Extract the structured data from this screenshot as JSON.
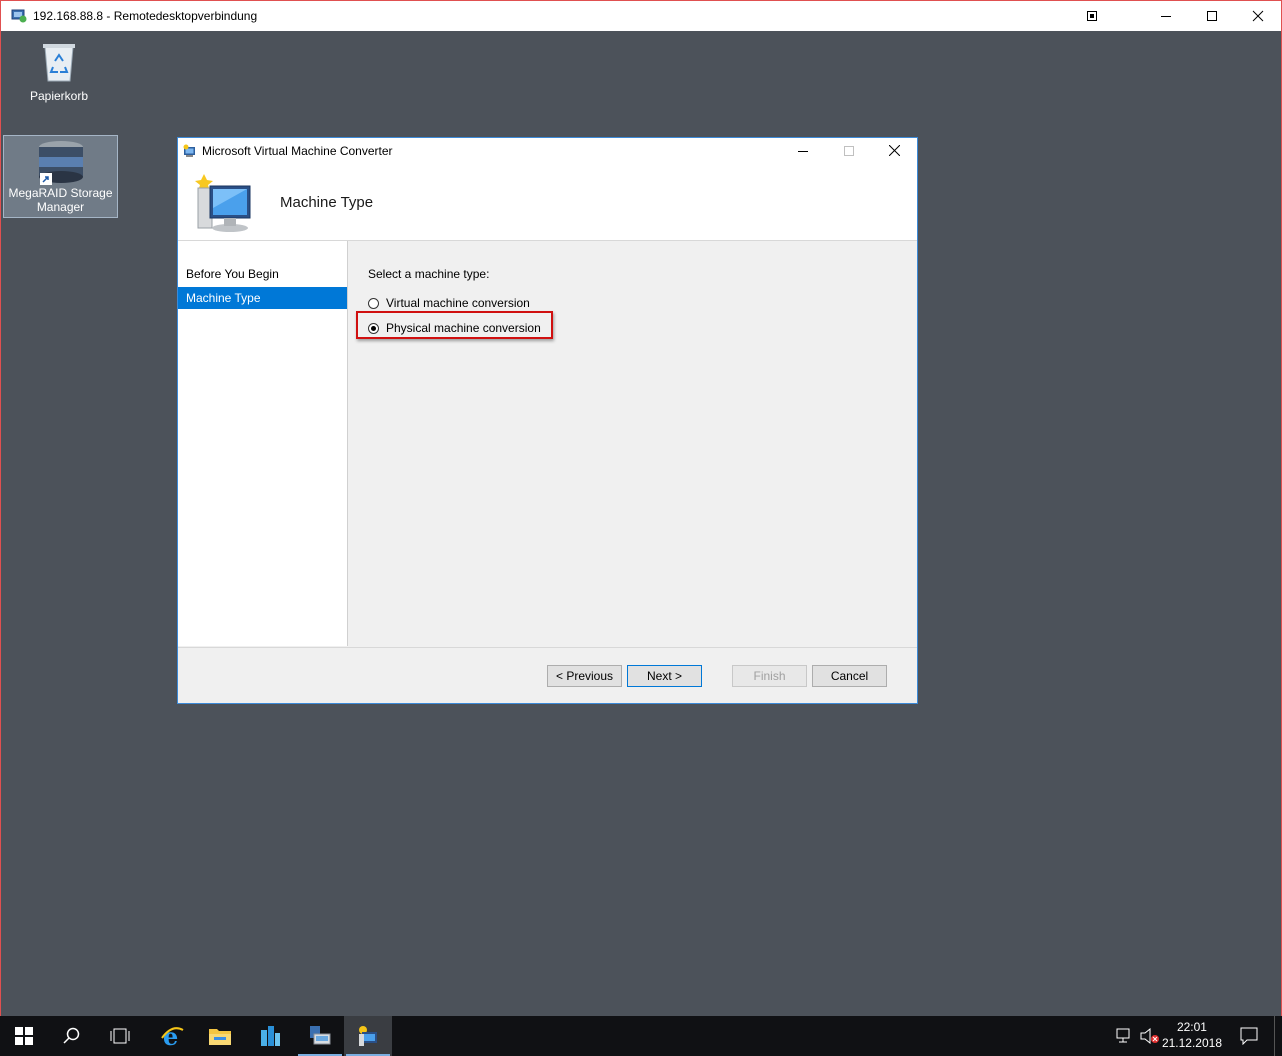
{
  "rdp_window": {
    "title": "192.168.88.8 - Remotedesktopverbindung",
    "icon": "remote-desktop-icon",
    "controls": [
      "pin-icon",
      "minimize-icon",
      "maximize-icon",
      "close-icon"
    ]
  },
  "desktop": {
    "icons": [
      {
        "label": "Papierkorb",
        "icon": "recycle-bin-icon"
      },
      {
        "label": "MegaRAID Storage Manager",
        "icon": "storage-manager-icon"
      }
    ]
  },
  "dialog": {
    "title": "Microsoft Virtual Machine Converter",
    "heading": "Machine Type",
    "nav": [
      {
        "label": "Before You Begin",
        "active": false
      },
      {
        "label": "Machine Type",
        "active": true
      }
    ],
    "prompt": "Select a machine type:",
    "options": [
      {
        "label": "Virtual machine conversion",
        "checked": false
      },
      {
        "label": "Physical machine conversion",
        "checked": true
      }
    ],
    "buttons": {
      "previous": "< Previous",
      "next": "Next >",
      "finish": "Finish",
      "cancel": "Cancel"
    }
  },
  "taskbar": {
    "items": [
      "start-icon",
      "search-icon",
      "task-view-icon",
      "internet-explorer-icon",
      "file-explorer-icon",
      "server-manager-icon",
      "remote-desktop-icon",
      "vm-converter-icon"
    ],
    "time": "22:01",
    "date": "21.12.2018"
  },
  "colors": {
    "desktop": "#4c525a",
    "accent": "#0078d7",
    "highlight_border": "#d01010"
  }
}
